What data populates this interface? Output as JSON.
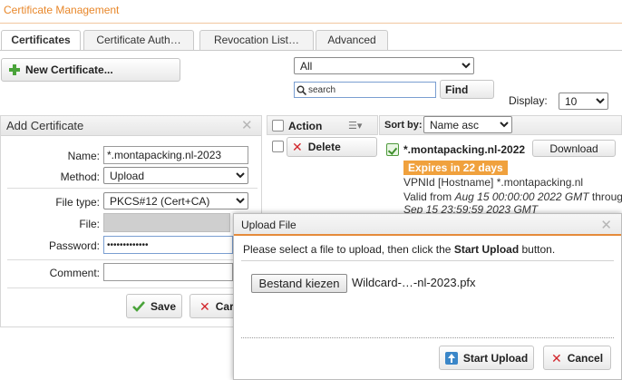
{
  "page": {
    "title": "Certificate Management"
  },
  "tabs": [
    {
      "label": "Certificates"
    },
    {
      "label": "Certificate Auth…"
    },
    {
      "label": "Revocation List…"
    },
    {
      "label": "Advanced"
    }
  ],
  "toolbar": {
    "new_certificate_label": "New Certificate...",
    "filter_selected": "All",
    "search_placeholder": "search",
    "find_label": "Find",
    "display_label": "Display:",
    "display_value": "10"
  },
  "add_certificate": {
    "title": "Add Certificate",
    "name_label": "Name:",
    "name_value": "*.montapacking.nl-2023",
    "method_label": "Method:",
    "method_value": "Upload",
    "filetype_label": "File type:",
    "filetype_value": "PKCS#12 (Cert+CA)",
    "file_label": "File:",
    "password_label": "Password:",
    "password_value": "•••••••••••••",
    "comment_label": "Comment:",
    "comment_value": "",
    "save_label": "Save",
    "cancel_label": "Car"
  },
  "list": {
    "action_header": "Action",
    "sort_label": "Sort by:",
    "sort_value": "Name asc",
    "delete_label": "Delete",
    "cert_name": "*.montapacking.nl-2022",
    "download_label": "Download",
    "expires_badge": "Expires in 22 days",
    "vpn_id": "VPNId [Hostname] *.montapacking.nl",
    "valid_from_prefix": "Valid from ",
    "valid_from": "Aug 15 00:00:00 2022 GMT",
    "valid_through": " throug",
    "valid_until": "Sep 15 23:59:59 2023 GMT"
  },
  "upload_modal": {
    "title": "Upload File",
    "message_prefix": "Please select a file to upload, then click the ",
    "message_bold": "Start Upload",
    "message_suffix": " button.",
    "choose_file_label": "Bestand kiezen",
    "file_name": "Wildcard-…-nl-2023.pfx",
    "start_upload_label": "Start Upload",
    "cancel_label": "Cancel"
  },
  "colors": {
    "accent": "#e8872a",
    "badge": "#f0a13d",
    "danger": "#d2252b",
    "success": "#4aa33a"
  }
}
